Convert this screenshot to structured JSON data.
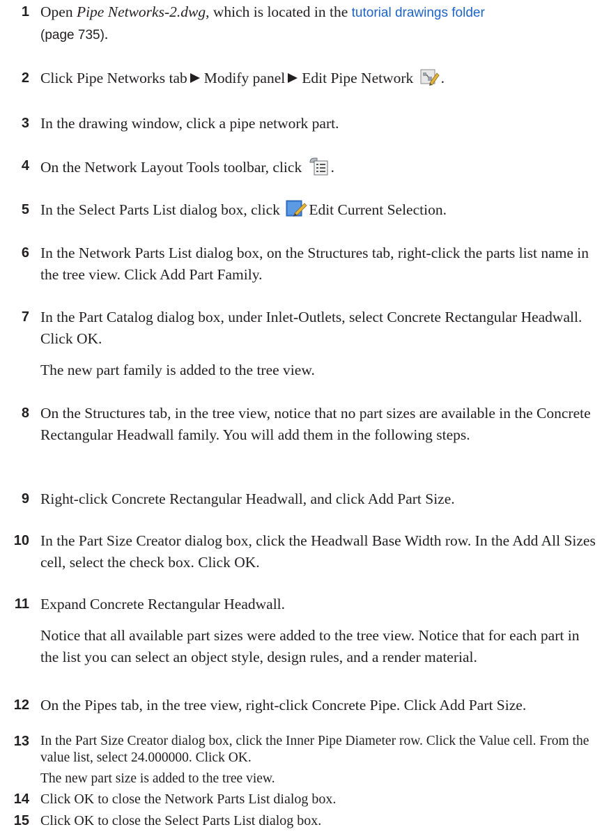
{
  "steps": [
    {
      "n": "1",
      "t_pre": "Open ",
      "t_file": "Pipe Networks-2.dwg",
      "t_mid": ", which is located in the ",
      "t_link": "tutorial drawings folder",
      "t_page": "(page 735)",
      "t_end": "."
    },
    {
      "n": "2",
      "t_a": "Click Pipe Networks tab",
      "t_b": "Modify panel",
      "t_c": "Edit Pipe Network",
      "t_end": ".",
      "icon": "edit-pipe-network-icon"
    },
    {
      "n": "3",
      "t": "In the drawing window, click a pipe network part."
    },
    {
      "n": "4",
      "t": "On the Network Layout Tools toolbar, click",
      "t_end": ".",
      "icon": "parts-list-icon"
    },
    {
      "n": "5",
      "t_pre": "In the Select Parts List dialog box, click",
      "t_post": "Edit Current Selection.",
      "icon": "edit-selection-icon"
    },
    {
      "n": "6",
      "t": "In the Network Parts List dialog box, on the Structures tab, right-click the parts list name in the tree view. Click Add Part Family."
    },
    {
      "n": "7",
      "t": "In the Part Catalog dialog box, under Inlet-Outlets, select Concrete Rectangular Headwall. Click OK.",
      "note": "The new part family is added to the tree view."
    },
    {
      "n": "8",
      "t": "On the Structures tab, in the tree view, notice that no part sizes are available in the Concrete Rectangular Headwall family. You will add them in the following steps."
    },
    {
      "n": "9",
      "t": "Right-click Concrete Rectangular Headwall, and click Add Part Size."
    },
    {
      "n": "10",
      "t": "In the Part Size Creator dialog box, click the Headwall Base Width row. In the Add All Sizes cell, select the check box. Click OK."
    },
    {
      "n": "11",
      "t": "Expand Concrete Rectangular Headwall.",
      "note": "Notice that all available part sizes were added to the tree view. Notice that for each part in the list you can select an object style, design rules, and a render material."
    },
    {
      "n": "12",
      "t": "On the Pipes tab, in the tree view, right-click Concrete Pipe. Click Add Part Size."
    },
    {
      "n": "13",
      "t": "In the Part Size Creator dialog box, click the Inner Pipe Diameter row. Click the Value cell. From the value list, select 24.000000. Click OK.",
      "note": "The new part size is added to the tree view."
    },
    {
      "n": "14",
      "t": "Click OK to close the Network Parts List dialog box."
    },
    {
      "n": "15",
      "t": "Click OK to close the Select Parts List dialog box."
    }
  ]
}
